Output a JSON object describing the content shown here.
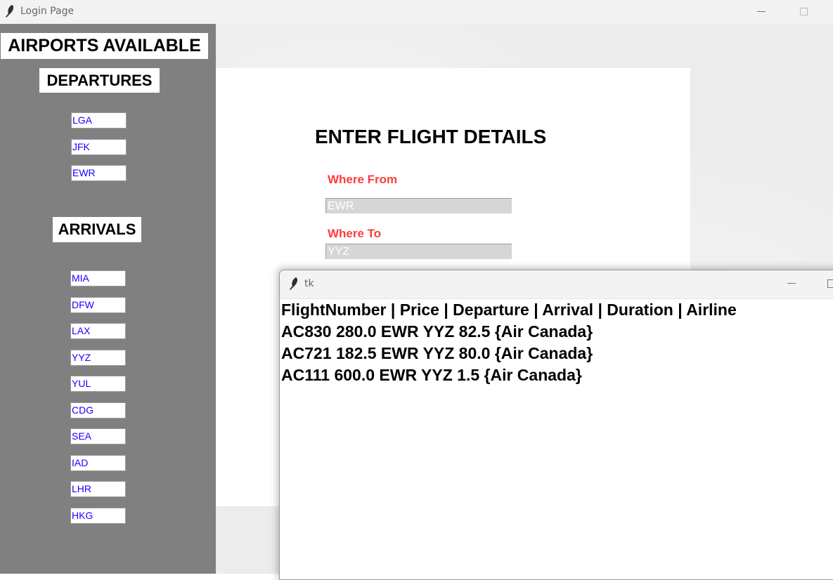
{
  "window": {
    "title": "Login Page"
  },
  "sidebar": {
    "title": "AIRPORTS AVAILABLE",
    "departures_heading": "DEPARTURES",
    "departures": [
      "LGA",
      "JFK",
      "EWR"
    ],
    "arrivals_heading": "ARRIVALS",
    "arrivals": [
      "MIA",
      "DFW",
      "LAX",
      "YYZ",
      "YUL",
      "CDG",
      "SEA",
      "IAD",
      "LHR",
      "HKG"
    ]
  },
  "form": {
    "title": "ENTER FLIGHT DETAILS",
    "from_label": "Where From",
    "from_value": "EWR",
    "to_label": "Where To",
    "to_value": "YYZ"
  },
  "popup": {
    "title": "tk",
    "lines": [
      "FlightNumber | Price | Departure | Arrival | Duration | Airline",
      "AC830 280.0 EWR YYZ 82.5 {Air Canada}",
      "AC721 182.5 EWR YYZ 80.0 {Air Canada}",
      "AC111 600.0 EWR YYZ 1.5 {Air Canada}"
    ]
  },
  "colors": {
    "sidebar_bg": "#808080",
    "label_red": "#ff3a3a",
    "chip_text": "#1a00ff",
    "field_bg": "#d6d6d6"
  },
  "icons": {
    "app_icon": "feather-icon"
  }
}
